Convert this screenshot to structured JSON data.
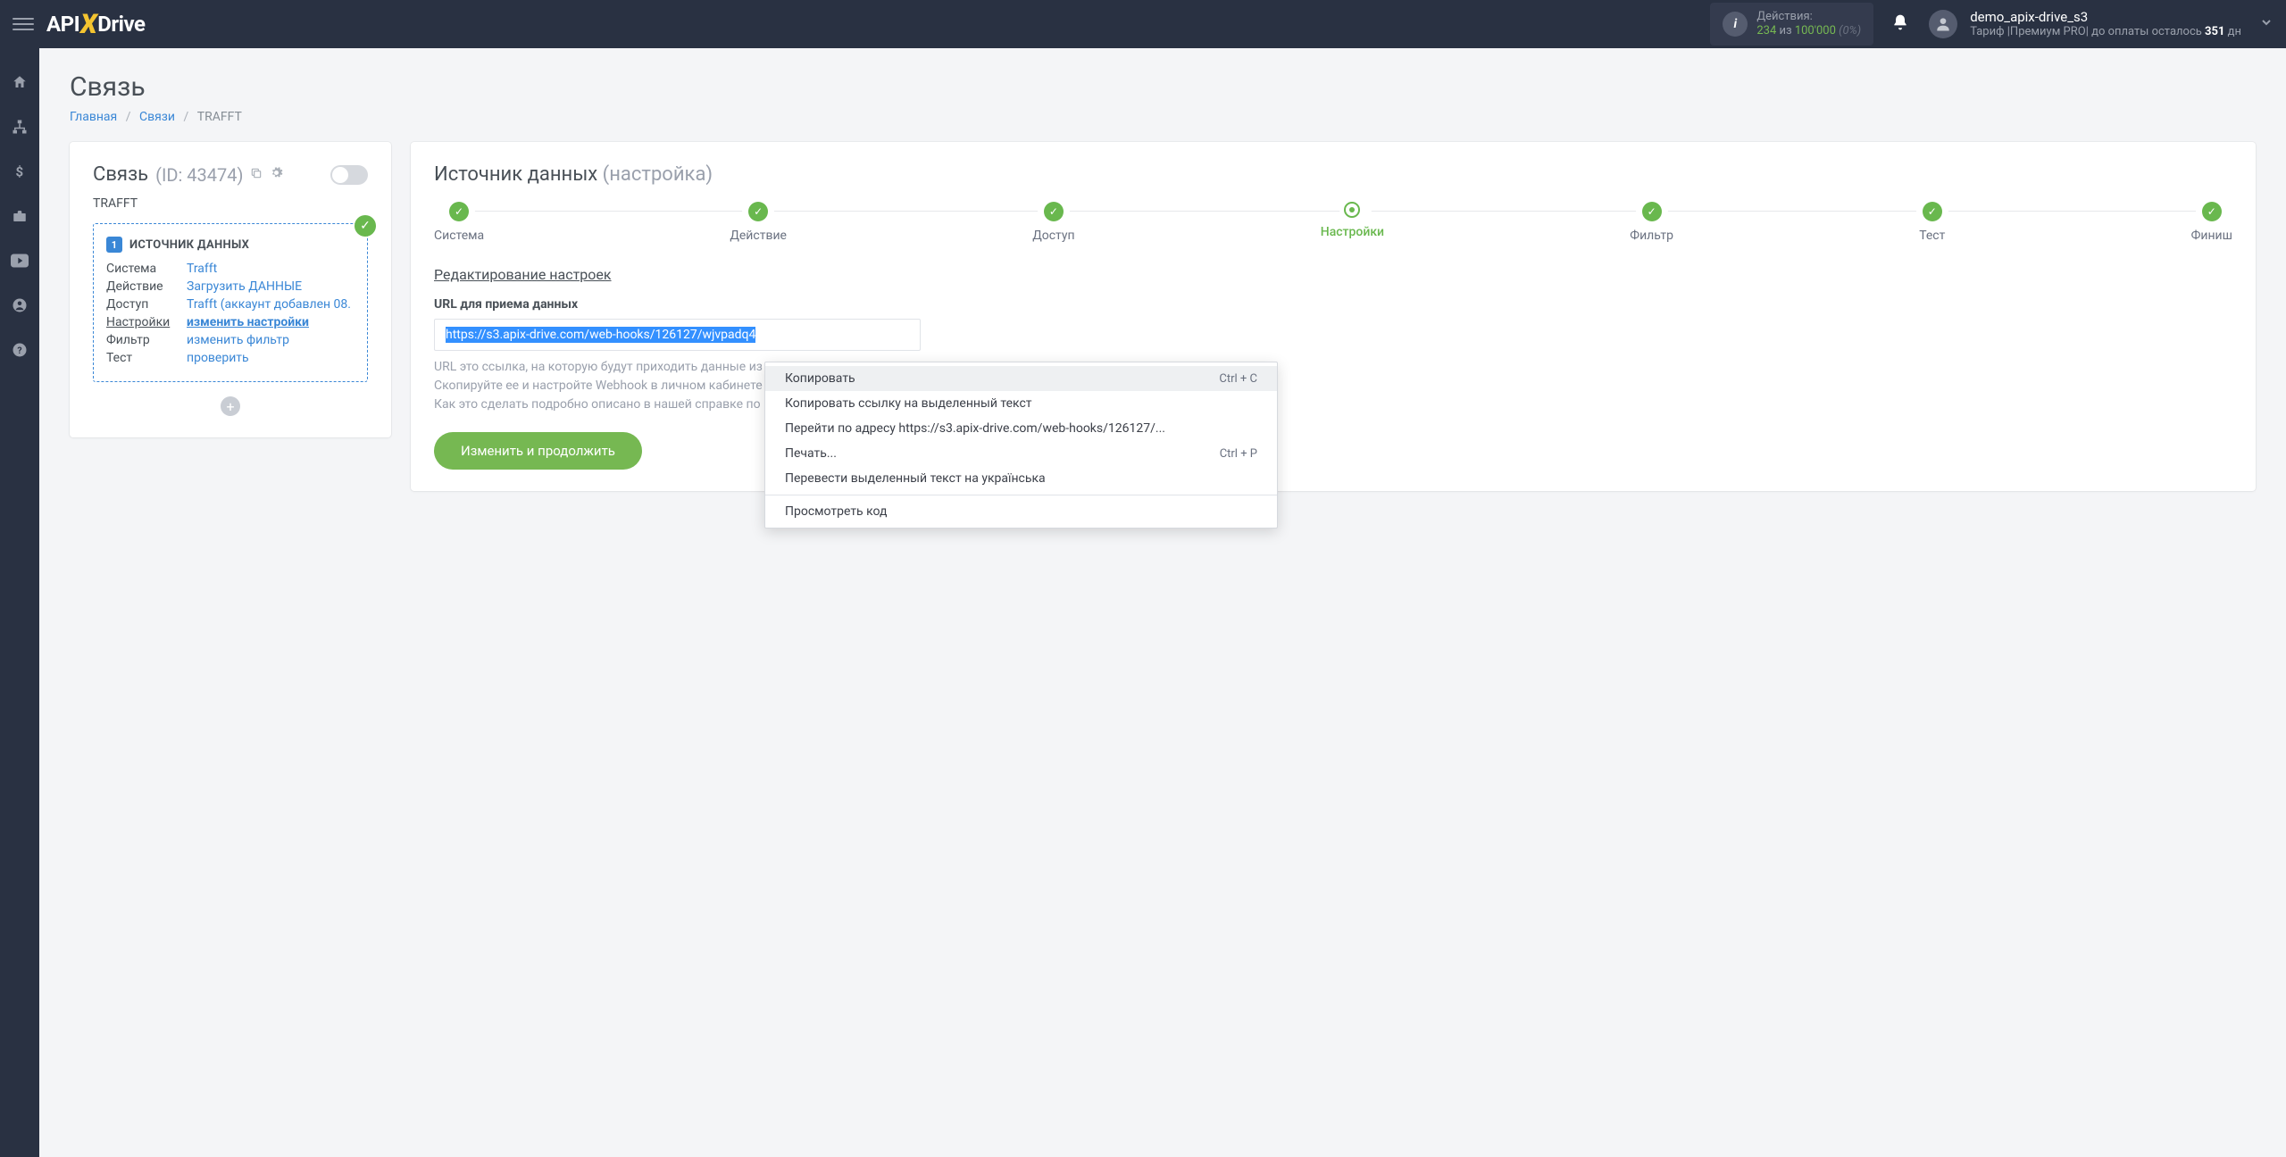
{
  "header": {
    "actions_label": "Действия:",
    "actions_used": "234",
    "actions_sep": " из ",
    "actions_total": "100'000",
    "actions_pct": "(0%)",
    "user_name": "demo_apix-drive_s3",
    "tariff_prefix": "Тариф |Премиум PRO|  до оплаты осталось ",
    "days_left": "351",
    "days_suffix": " дн"
  },
  "page": {
    "title": "Связь",
    "breadcrumb_home": "Главная",
    "breadcrumb_links": "Связи",
    "breadcrumb_current": "TRAFFT"
  },
  "left": {
    "title": "Связь",
    "id_label": "(ID: 43474)",
    "conn_name": "TRAFFT",
    "source_title": "ИСТОЧНИК ДАННЫХ",
    "rows": [
      {
        "key": "Система",
        "val": "Trafft"
      },
      {
        "key": "Действие",
        "val": "Загрузить ДАННЫЕ"
      },
      {
        "key": "Доступ",
        "val": "Trafft (аккаунт добавлен 08."
      },
      {
        "key": "Настройки",
        "val": "изменить настройки",
        "active": true
      },
      {
        "key": "Фильтр",
        "val": "изменить фильтр"
      },
      {
        "key": "Тест",
        "val": "проверить"
      }
    ]
  },
  "right": {
    "title_main": "Источник данных",
    "title_paren": "(настройка)",
    "steps": [
      {
        "label": "Система",
        "done": true
      },
      {
        "label": "Действие",
        "done": true
      },
      {
        "label": "Доступ",
        "done": true
      },
      {
        "label": "Настройки",
        "current": true
      },
      {
        "label": "Фильтр",
        "done": true
      },
      {
        "label": "Тест",
        "done": true
      },
      {
        "label": "Финиш",
        "done": true
      }
    ],
    "section_title": "Редактирование настроек",
    "field_label": "URL для приема данных",
    "url_value": "https://s3.apix-drive.com/web-hooks/126127/wjvpadq4",
    "helper_l1": "URL это ссылка, на которую будут приходить данные из",
    "helper_l2": "Скопируйте ее и настройте Webhook в личном кабинете",
    "helper_l3": "Как это сделать подробно описано в нашей справке по",
    "button": "Изменить и продолжить"
  },
  "context_menu": {
    "items": [
      {
        "label": "Копировать",
        "shortcut": "Ctrl + C",
        "highlighted": true
      },
      {
        "label": "Копировать ссылку на выделенный текст"
      },
      {
        "label": "Перейти по адресу https://s3.apix-drive.com/web-hooks/126127/..."
      },
      {
        "label": "Печать...",
        "shortcut": "Ctrl + P"
      },
      {
        "label": "Перевести выделенный текст на українська"
      },
      {
        "divider": true
      },
      {
        "label": "Просмотреть код"
      }
    ]
  }
}
